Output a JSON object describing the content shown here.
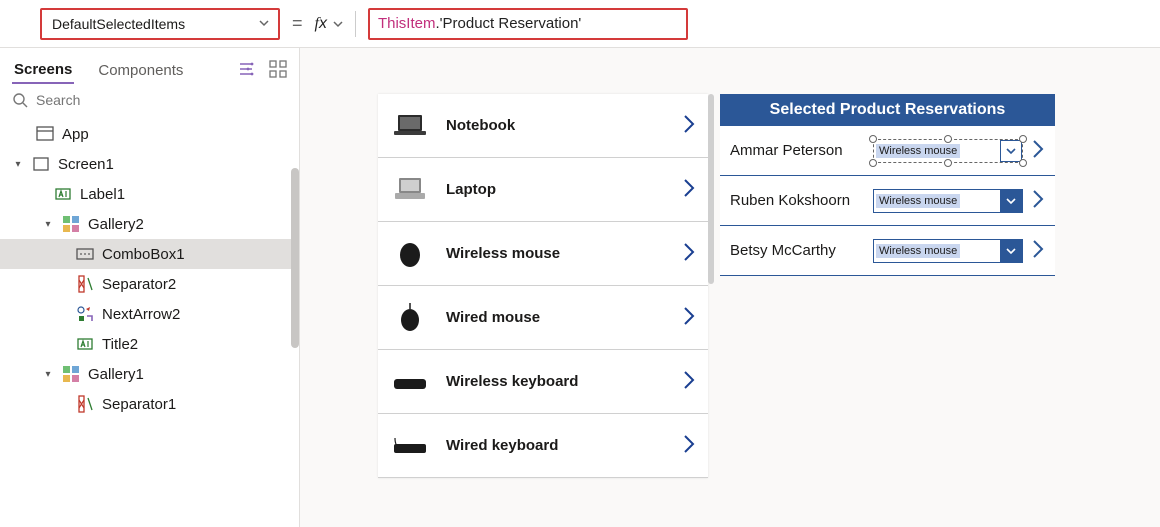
{
  "formula_bar": {
    "property": "DefaultSelectedItems",
    "equals": "=",
    "fx_label": "fx",
    "formula_this": "ThisItem",
    "formula_rest": ".'Product Reservation'"
  },
  "left_panel": {
    "tabs": {
      "screens": "Screens",
      "components": "Components"
    },
    "search_placeholder": "Search",
    "tree": {
      "app": "App",
      "screen1": "Screen1",
      "label1": "Label1",
      "gallery2": "Gallery2",
      "combobox1": "ComboBox1",
      "separator2": "Separator2",
      "nextarrow2": "NextArrow2",
      "title2": "Title2",
      "gallery1": "Gallery1",
      "separator1": "Separator1"
    }
  },
  "canvas": {
    "products": [
      {
        "name": "Notebook"
      },
      {
        "name": "Laptop"
      },
      {
        "name": "Wireless mouse"
      },
      {
        "name": "Wired mouse"
      },
      {
        "name": "Wireless keyboard"
      },
      {
        "name": "Wired keyboard"
      }
    ],
    "reservations": {
      "header": "Selected Product Reservations",
      "rows": [
        {
          "name": "Ammar Peterson",
          "combo": "Wireless mouse"
        },
        {
          "name": "Ruben Kokshoorn",
          "combo": "Wireless mouse"
        },
        {
          "name": "Betsy McCarthy",
          "combo": "Wireless mouse"
        }
      ]
    }
  },
  "colors": {
    "accent": "#2b5797",
    "highlight_border": "#d43a3a",
    "purple": "#8764b8"
  }
}
